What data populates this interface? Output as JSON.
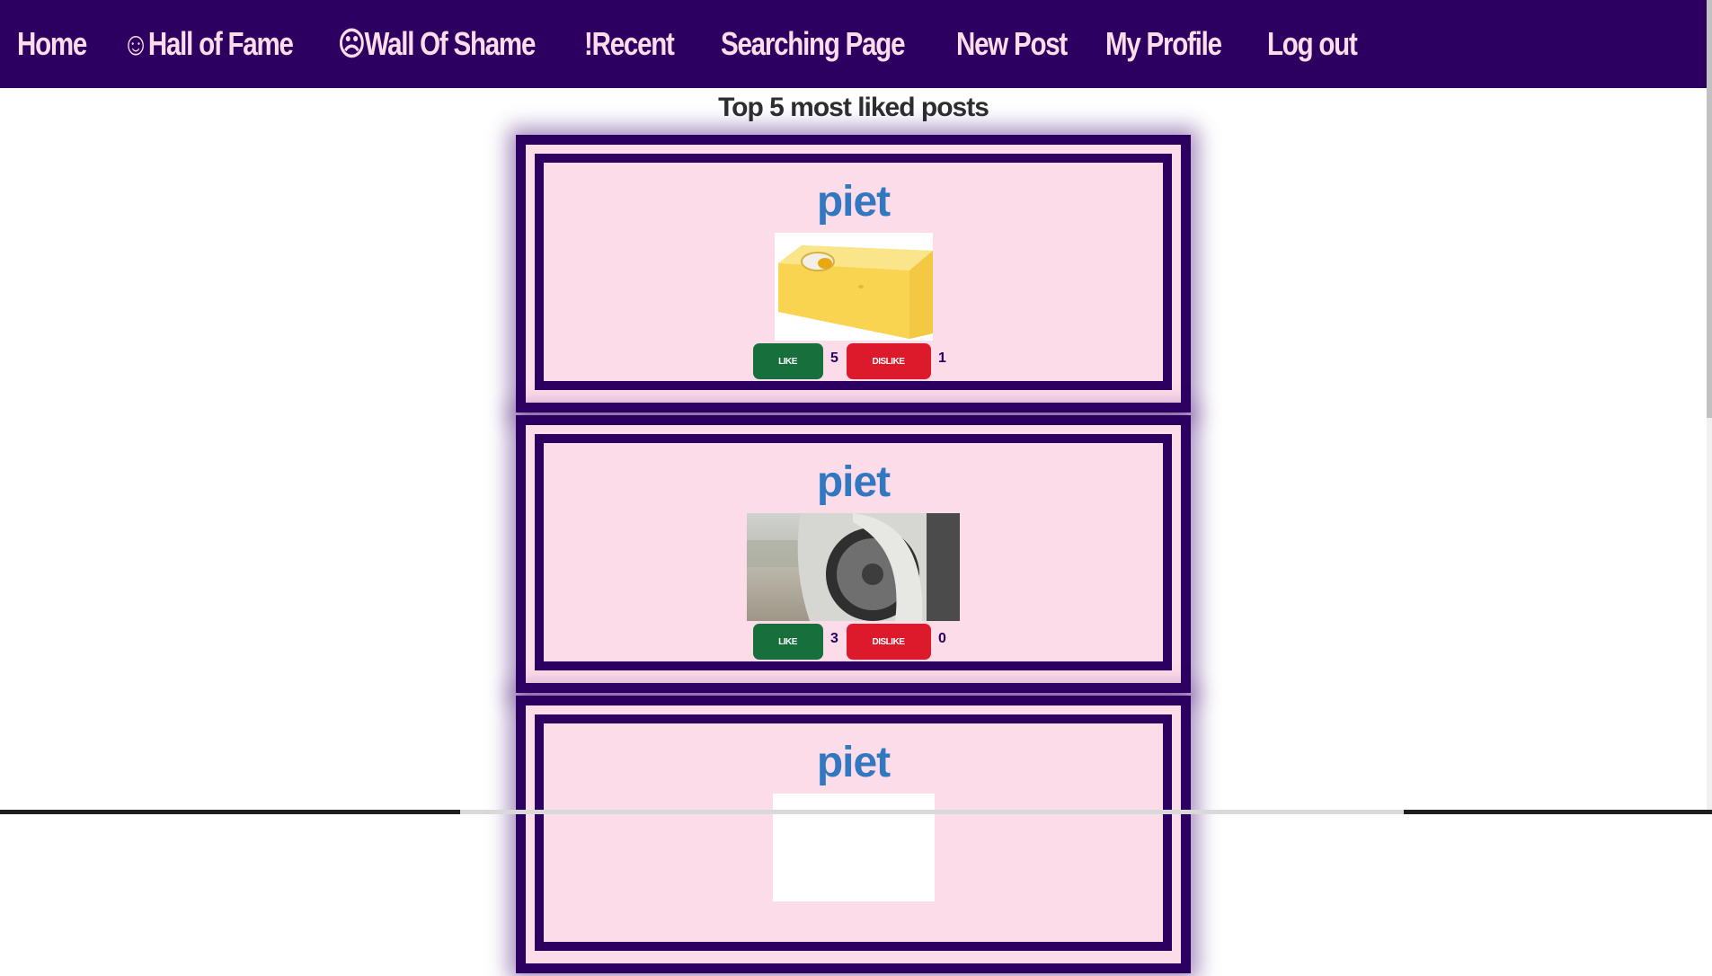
{
  "nav": {
    "links": [
      "Home",
      "☺Hall of Fame",
      "☹Wall Of Shame",
      "!Recent",
      "Searching Page",
      "New Post",
      "My Profile",
      "Log out"
    ]
  },
  "page": {
    "title": "Top 5 most liked posts"
  },
  "posts": [
    {
      "author": "piet",
      "image": "cheese-block-photo",
      "like_label": "LIKE",
      "likes": "5",
      "dislike_label": "DISLIKE",
      "dislikes": "1"
    },
    {
      "author": "piet",
      "image": "car-wheel-photo",
      "like_label": "LIKE",
      "likes": "3",
      "dislike_label": "DISLIKE",
      "dislikes": "0"
    },
    {
      "author": "piet"
    }
  ],
  "colors": {
    "nav_bg": "#2b0060",
    "nav_text": "#fddcea",
    "card_bg": "#fddcea",
    "author": "#3178c0",
    "like": "#17703c",
    "dislike": "#dc1a2c"
  }
}
